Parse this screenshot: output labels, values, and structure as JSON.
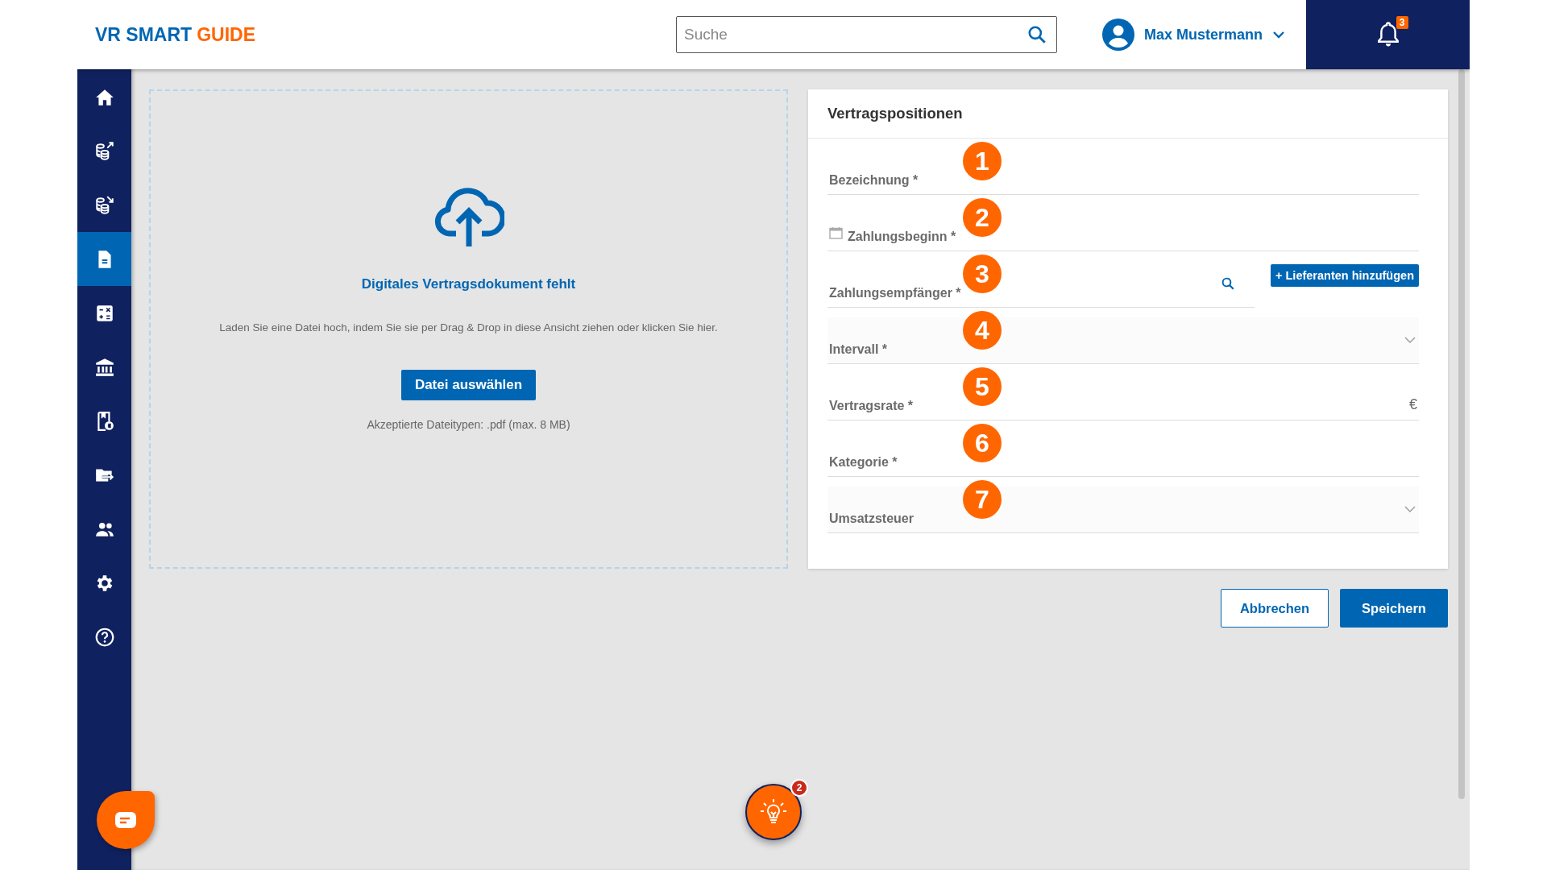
{
  "header": {
    "logo": {
      "brand": "VR SMART",
      "product": "GUIDE"
    },
    "search": {
      "placeholder": "Suche"
    },
    "user": {
      "name": "Max Mustermann"
    },
    "notifications": {
      "count": "3"
    }
  },
  "sidebar": {
    "items": [
      {
        "selected": false
      },
      {
        "selected": false
      },
      {
        "selected": false
      },
      {
        "selected": true
      },
      {
        "selected": false
      },
      {
        "selected": false
      },
      {
        "selected": false
      },
      {
        "selected": false
      },
      {
        "selected": false
      },
      {
        "selected": false
      },
      {
        "selected": false
      }
    ]
  },
  "upload": {
    "title": "Digitales Vertragsdokument fehlt",
    "hint": "Laden Sie eine Datei hoch, indem Sie sie per Drag & Drop in diese Ansicht ziehen oder klicken Sie hier.",
    "button": "Datei auswählen",
    "accepted": "Akzeptierte Dateitypen: .pdf (max. 8 MB)"
  },
  "form": {
    "title": "Vertragspositionen",
    "fields": [
      {
        "label": "Bezeichnung *",
        "kind": "text",
        "marker": "1"
      },
      {
        "label": "Zahlungsbeginn *",
        "kind": "date",
        "marker": "2"
      },
      {
        "label": "Zahlungsempfänger *",
        "kind": "search",
        "marker": "3",
        "action": "+ Lieferanten hinzufügen"
      },
      {
        "label": "Intervall *",
        "kind": "select",
        "marker": "4"
      },
      {
        "label": "Vertragsrate *",
        "kind": "currency",
        "marker": "5",
        "suffix": "€"
      },
      {
        "label": "Kategorie *",
        "kind": "text",
        "marker": "6"
      },
      {
        "label": "Umsatzsteuer",
        "kind": "select",
        "marker": "7"
      }
    ],
    "cancel": "Abbrechen",
    "save": "Speichern"
  },
  "tips": {
    "count": "2"
  }
}
